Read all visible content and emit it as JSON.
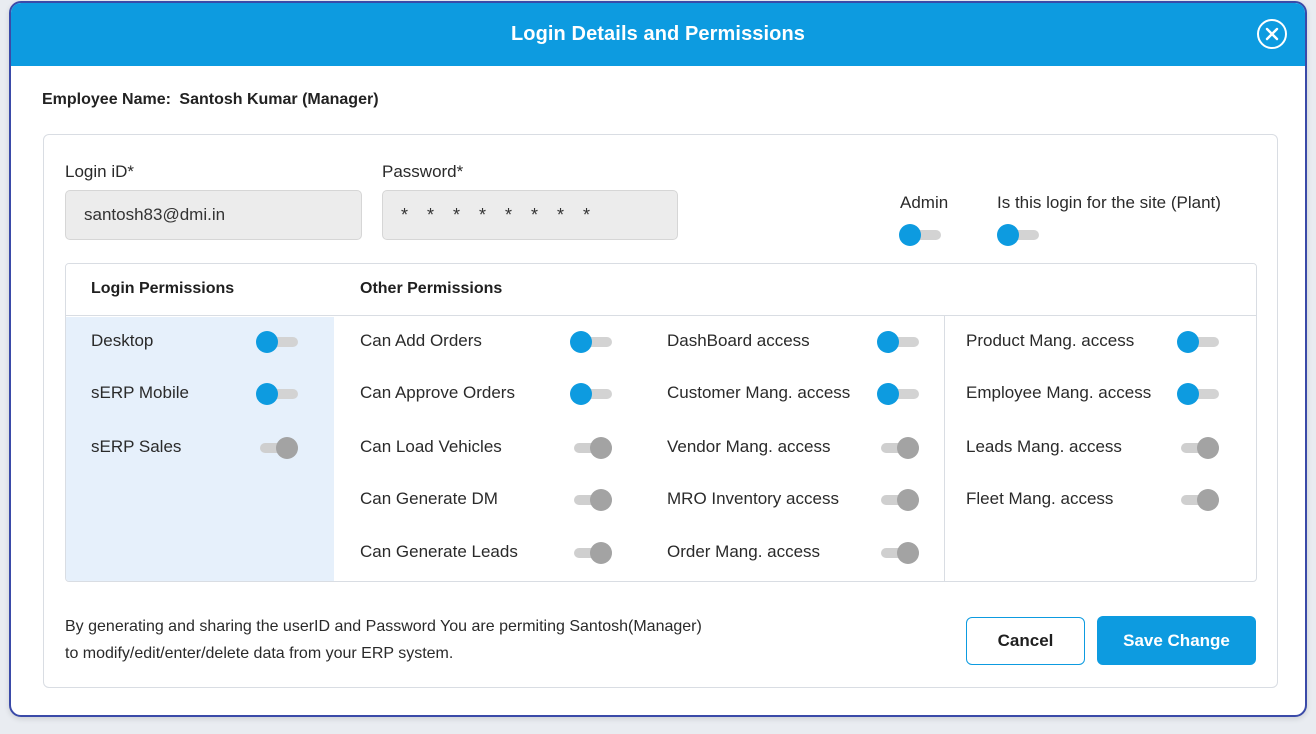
{
  "dialog": {
    "title": "Login Details and Permissions",
    "close_icon": "close-circle-icon"
  },
  "employee": {
    "label": "Employee Name:",
    "value": "Santosh Kumar (Manager)"
  },
  "credentials": {
    "login_label": "Login iD*",
    "login_value": "santosh83@dmi.in",
    "password_label": "Password*",
    "password_value": "* * * * * * * *"
  },
  "switches": {
    "admin_label": "Admin",
    "admin_on": true,
    "site_label": "Is this login for the site (Plant)",
    "site_on": true
  },
  "permissions": {
    "login_header": "Login Permissions",
    "other_header": "Other Permissions",
    "login": [
      {
        "label": "Desktop",
        "on": true
      },
      {
        "label": "sERP Mobile",
        "on": true
      },
      {
        "label": "sERP Sales",
        "on": false
      }
    ],
    "col1": [
      {
        "label": "Can Add Orders",
        "on": true
      },
      {
        "label": "Can Approve Orders",
        "on": true
      },
      {
        "label": "Can Load Vehicles",
        "on": false
      },
      {
        "label": "Can Generate DM",
        "on": false
      },
      {
        "label": "Can Generate Leads",
        "on": false
      }
    ],
    "col2": [
      {
        "label": "DashBoard access",
        "on": true
      },
      {
        "label": "Customer Mang. access",
        "on": true
      },
      {
        "label": "Vendor Mang. access",
        "on": false
      },
      {
        "label": "MRO Inventory access",
        "on": false
      },
      {
        "label": "Order Mang. access",
        "on": false
      }
    ],
    "col3": [
      {
        "label": "Product Mang. access",
        "on": true
      },
      {
        "label": "Employee Mang. access",
        "on": true
      },
      {
        "label": "Leads Mang. access",
        "on": false
      },
      {
        "label": "Fleet Mang. access",
        "on": false
      }
    ]
  },
  "footer": {
    "line1": "By generating and sharing the userID and Password You are permiting Santosh(Manager)",
    "line2": "to modify/edit/enter/delete data from your ERP system.",
    "cancel_label": "Cancel",
    "save_label": "Save Change"
  },
  "colors": {
    "accent": "#0d9be0",
    "login_column_bg": "#e6f0fb",
    "toggle_off_knob": "#a3a3a3"
  }
}
